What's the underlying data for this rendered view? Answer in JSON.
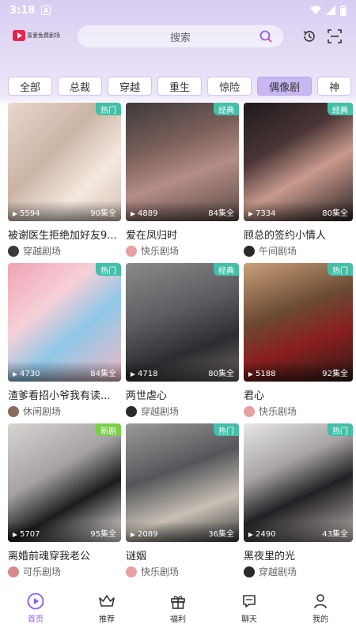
{
  "status": {
    "time": "3:18"
  },
  "header": {
    "logo_text": "喜爱免费剧场",
    "search_placeholder": "搜索"
  },
  "tabs": [
    {
      "label": "全部"
    },
    {
      "label": "总裁"
    },
    {
      "label": "穿越"
    },
    {
      "label": "重生"
    },
    {
      "label": "惊险"
    },
    {
      "label": "偶像剧"
    },
    {
      "label": "神"
    }
  ],
  "colors": {
    "accent": "#8a5cf0",
    "badge": "#44bfa8",
    "badge_new": "#7bd04b"
  },
  "cards": [
    {
      "badge": "热门",
      "plays": "5594",
      "episodes": "90集全",
      "title": "被谢医生拒绝加好友9...",
      "studio": "穿越剧场"
    },
    {
      "badge": "经典",
      "plays": "4889",
      "episodes": "84集全",
      "title": "爱在凤归时",
      "studio": "快乐剧场"
    },
    {
      "badge": "经典",
      "plays": "7334",
      "episodes": "80集全",
      "title": "顾总的签约小情人",
      "studio": "午间剧场"
    },
    {
      "badge": "热门",
      "plays": "4730",
      "episodes": "84集全",
      "title": "渣爹看招小爷我有读...",
      "studio": "休闲剧场"
    },
    {
      "badge": "经典",
      "plays": "4718",
      "episodes": "80集全",
      "title": "两世虐心",
      "studio": "穿越剧场"
    },
    {
      "badge": "热门",
      "plays": "5188",
      "episodes": "92集全",
      "title": "君心",
      "studio": "快乐剧场"
    },
    {
      "badge": "新剧",
      "plays": "5707",
      "episodes": "95集全",
      "title": "离婚前魂穿我老公",
      "studio": "可乐剧场"
    },
    {
      "badge": "热门",
      "plays": "2089",
      "episodes": "36集全",
      "title": "谜姻",
      "studio": "快乐剧场"
    },
    {
      "badge": "热门",
      "plays": "2490",
      "episodes": "43集全",
      "title": "黑夜里的光",
      "studio": "穿越剧场"
    }
  ],
  "nav": [
    {
      "label": "首页",
      "icon": "home-play-icon"
    },
    {
      "label": "推荐",
      "icon": "crown-icon"
    },
    {
      "label": "福利",
      "icon": "gift-icon"
    },
    {
      "label": "聊天",
      "icon": "chat-icon"
    },
    {
      "label": "我的",
      "icon": "person-icon"
    }
  ]
}
